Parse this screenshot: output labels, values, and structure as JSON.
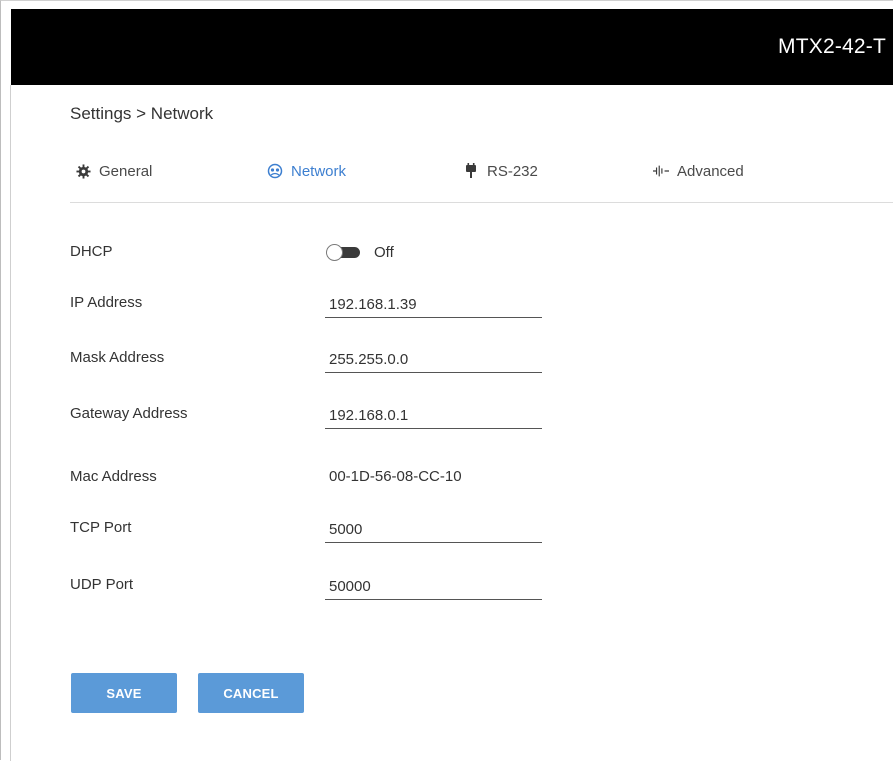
{
  "header": {
    "device_name": "MTX2-42-T"
  },
  "breadcrumb": "Settings > Network",
  "tabs": [
    {
      "label": "General",
      "icon": "gear-icon",
      "active": false
    },
    {
      "label": "Network",
      "icon": "network-icon",
      "active": true
    },
    {
      "label": "RS-232",
      "icon": "serial-plug-icon",
      "active": false
    },
    {
      "label": "Advanced",
      "icon": "waveform-icon",
      "active": false
    }
  ],
  "form": {
    "dhcp": {
      "label": "DHCP",
      "state": "Off",
      "enabled": false
    },
    "ip_address": {
      "label": "IP Address",
      "value": "192.168.1.39"
    },
    "mask_address": {
      "label": "Mask Address",
      "value": "255.255.0.0"
    },
    "gateway_address": {
      "label": "Gateway Address",
      "value": "192.168.0.1"
    },
    "mac_address": {
      "label": "Mac Address",
      "value": "00-1D-56-08-CC-10"
    },
    "tcp_port": {
      "label": "TCP Port",
      "value": "5000"
    },
    "udp_port": {
      "label": "UDP Port",
      "value": "50000"
    }
  },
  "actions": {
    "save_label": "SAVE",
    "cancel_label": "CANCEL"
  },
  "colors": {
    "header_bg": "#000000",
    "accent": "#3d7fd0",
    "button_bg": "#5b9ad8"
  }
}
